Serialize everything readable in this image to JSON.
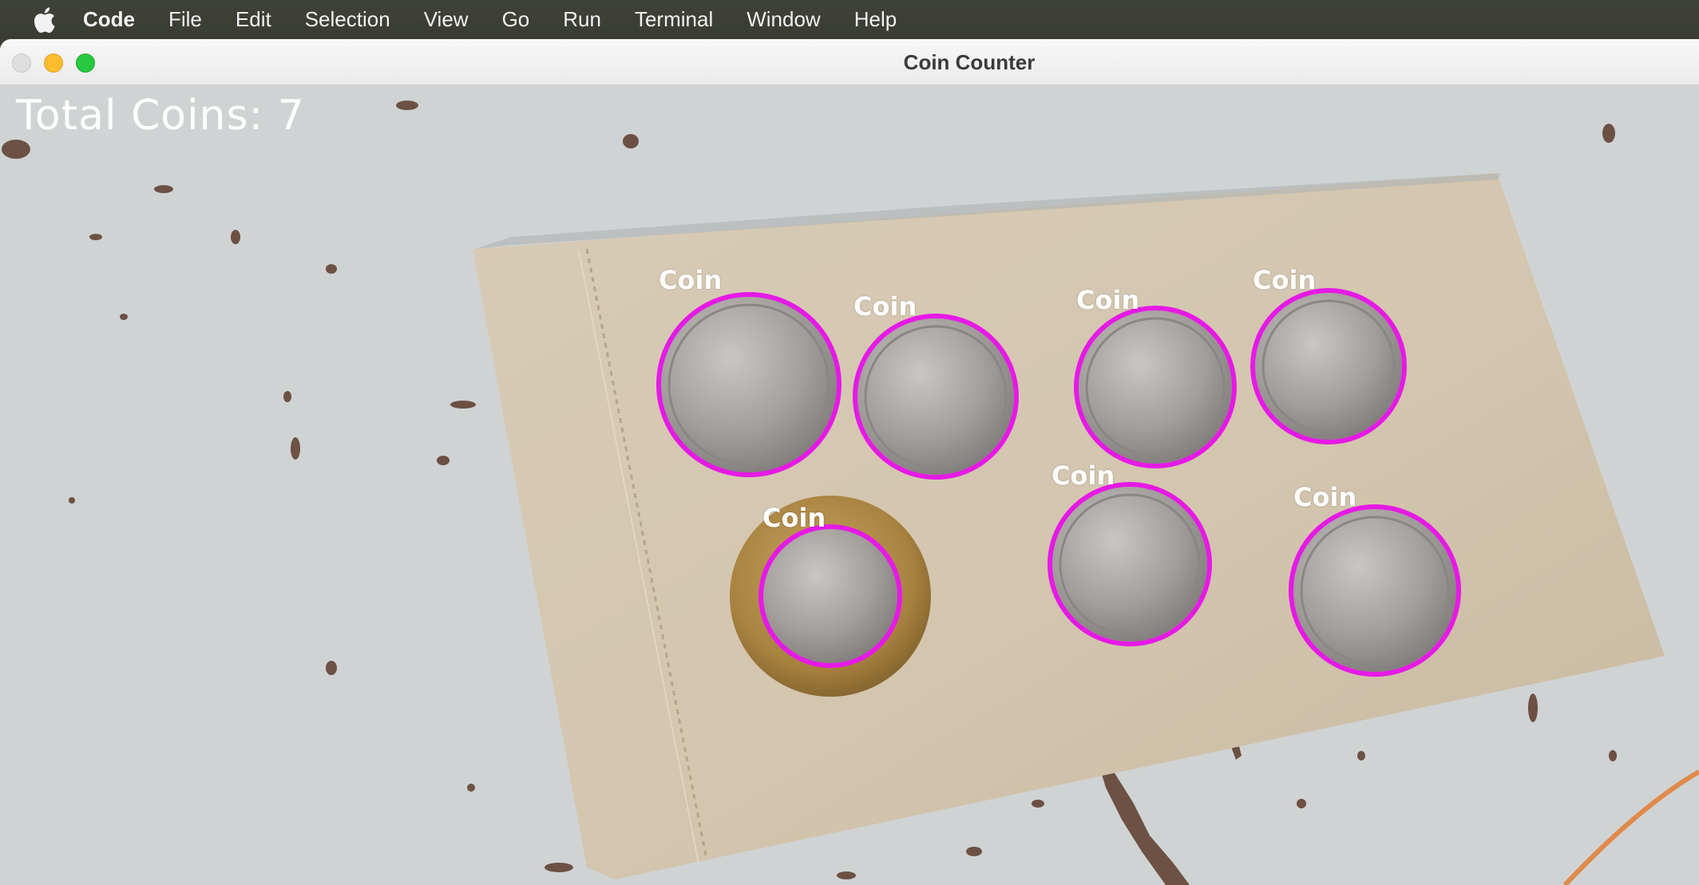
{
  "menubar": {
    "items": [
      "Code",
      "File",
      "Edit",
      "Selection",
      "View",
      "Go",
      "Run",
      "Terminal",
      "Window",
      "Help"
    ]
  },
  "window": {
    "title": "Coin Counter"
  },
  "overlay": {
    "total_label": "Total Coins: 7",
    "coin_label": "Coin",
    "highlight_color": "#e619e6"
  },
  "icons": {
    "apple": "apple-icon",
    "close": "close-button",
    "minimize": "minimize-button",
    "zoom": "zoom-button"
  }
}
